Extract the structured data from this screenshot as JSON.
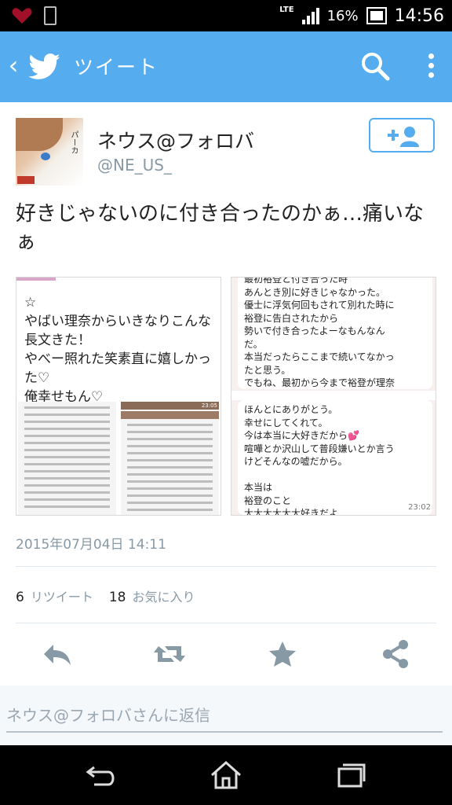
{
  "status_bar": {
    "network": "LTE",
    "battery_percent": "16%",
    "time": "14:56",
    "icons": [
      "heart-icon",
      "phone-icon",
      "signal-icon",
      "battery-icon"
    ]
  },
  "app_bar": {
    "title": "ツイート",
    "icons": [
      "back-icon",
      "twitter-bird-icon",
      "search-icon",
      "more-vertical-icon"
    ],
    "brand_color": "#55acee"
  },
  "tweet": {
    "user_name": "ネウス@フォロバ",
    "handle": "@NE_US_",
    "text": "好きじゃないのに付き合ったのかぁ…痛いなぁ",
    "avatar_tag": "パーカ",
    "images": {
      "left_text": "☆\nやばい理奈からいきなりこんな\n長文きた！\nやべー照れた笑素直に嬉しかっ\nた♡\n俺幸せもん♡",
      "right_top_text": "最初裕登と付き合った時\nあんとき別に好きじゃなかった。\n優士に浮気何回もされて別れた時に\n裕登に告白されたから\n勢いで付き合ったよーなもんなん\nだ。\n本当だったらここまで続いてなかっ\nたと思う。\nでもね、最初から今まで裕登が理奈\nのこと思ってくれてたからここま\nで続いてこれたんだなって思った。\nでもね、一ヶ月立つちょっと前から",
      "right_bottom_text": "ほんとにありがとう。\n幸せにしてくれて。\n今は本当に大好きだから💕\n喧嘩とか沢山して普段嫌いとか言う\nけどそんなの嘘だから。\n\n本当は\n裕登のこと\n大大大大大大好きだよ\n\nこれからもよろしくね",
      "right_bottom_time": "23:02",
      "mini_time": "23:05"
    },
    "date": "2015年07月04日 14:11",
    "retweet_count": "6",
    "retweet_label": "リツイート",
    "favorite_count": "18",
    "favorite_label": "お気に入り"
  },
  "actions": [
    "reply-icon",
    "retweet-icon",
    "favorite-icon",
    "share-icon"
  ],
  "reply": {
    "placeholder": "ネウス@フォロバさんに返信"
  },
  "nav_bar": {
    "icons": [
      "nav-back-icon",
      "home-icon",
      "recents-icon"
    ]
  }
}
